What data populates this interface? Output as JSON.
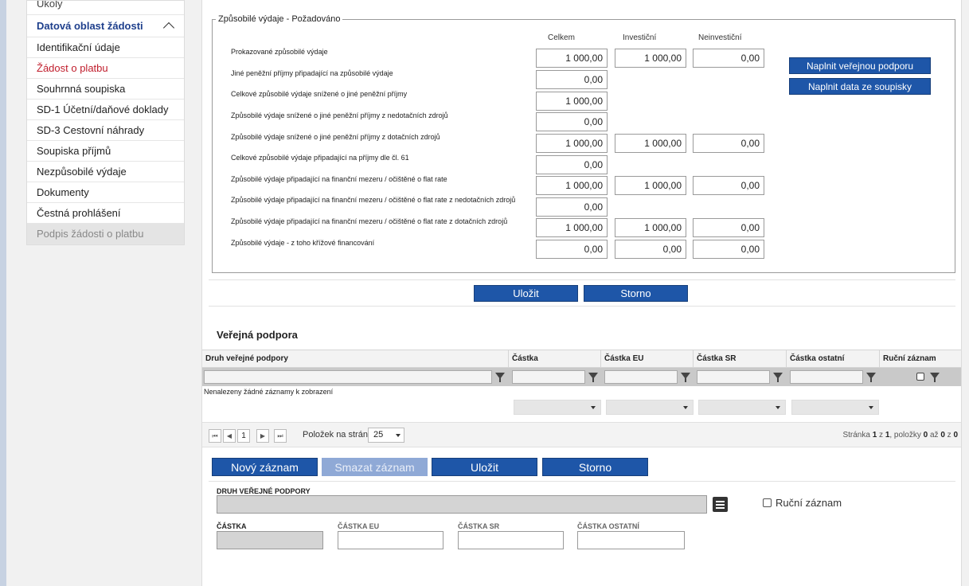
{
  "sidebar": {
    "items": [
      {
        "label": "Úkoly",
        "state": "cut"
      },
      {
        "label": "Datová oblast žádosti",
        "state": "section"
      },
      {
        "label": "Identifikační údaje",
        "state": "normal"
      },
      {
        "label": "Žádost o platbu",
        "state": "active"
      },
      {
        "label": "Souhrnná soupiska",
        "state": "normal"
      },
      {
        "label": "SD-1 Účetní/daňové doklady",
        "state": "normal"
      },
      {
        "label": "SD-3 Cestovní náhrady",
        "state": "normal"
      },
      {
        "label": "Soupiska příjmů",
        "state": "normal"
      },
      {
        "label": "Nezpůsobilé výdaje",
        "state": "normal"
      },
      {
        "label": "Dokumenty",
        "state": "normal"
      },
      {
        "label": "Čestná prohlášení",
        "state": "normal"
      },
      {
        "label": "Podpis žádosti o platbu",
        "state": "disabled"
      }
    ]
  },
  "expenses": {
    "legend": "Způsobilé výdaje - Požadováno",
    "columns": [
      "Celkem",
      "Investiční",
      "Neinvestiční"
    ],
    "rows": [
      {
        "label": "Prokazované způsobilé výdaje",
        "values": [
          "1 000,00",
          "1 000,00",
          "0,00"
        ]
      },
      {
        "label": "Jiné peněžní příjmy připadající na způsobilé výdaje",
        "values": [
          "0,00"
        ]
      },
      {
        "label": "Celkové způsobilé výdaje snížené o jiné peněžní příjmy",
        "values": [
          "1 000,00"
        ]
      },
      {
        "label": "Způsobilé výdaje snížené o jiné peněžní příjmy z nedotačních zdrojů",
        "values": [
          "0,00"
        ]
      },
      {
        "label": "Způsobilé výdaje snížené o jiné peněžní příjmy z dotačních zdrojů",
        "values": [
          "1 000,00",
          "1 000,00",
          "0,00"
        ]
      },
      {
        "label": "Celkové způsobilé výdaje připadající na příjmy dle čl. 61",
        "values": [
          "0,00"
        ]
      },
      {
        "label": "Způsobilé výdaje připadající na finanční mezeru / očištěné o flat rate",
        "values": [
          "1 000,00",
          "1 000,00",
          "0,00"
        ]
      },
      {
        "label": "Způsobilé výdaje připadající na finanční mezeru / očištěné o flat rate z nedotačních zdrojů",
        "values": [
          "0,00"
        ]
      },
      {
        "label": "Způsobilé výdaje připadající na finanční mezeru / očištěné o flat rate z dotačních zdrojů",
        "values": [
          "1 000,00",
          "1 000,00",
          "0,00"
        ]
      },
      {
        "label": "Způsobilé výdaje - z toho křížové financování",
        "values": [
          "0,00",
          "0,00",
          "0,00"
        ]
      }
    ],
    "btn_verejna": "Naplnit veřejnou podporu",
    "btn_soupisky": "Naplnit data ze soupisky"
  },
  "actions": {
    "save": "Uložit",
    "cancel": "Storno"
  },
  "vp": {
    "title": "Veřejná podpora",
    "columns": [
      "Druh veřejné podpory",
      "Částka",
      "Částka EU",
      "Částka SR",
      "Částka ostatní",
      "Ruční záznam"
    ],
    "empty": "Nenalezeny žádné záznamy k zobrazení",
    "pager": {
      "first": "⏮",
      "prev": "◀",
      "page": "1",
      "next": "▶",
      "last": "⏭",
      "per_page_label": "Položek na stránku",
      "per_page": "25",
      "info_prefix": "Stránka ",
      "page_cur": "1",
      "info_of": " z ",
      "page_total": "1",
      "info_items": ", položky ",
      "item_from": "0",
      "info_to": " až ",
      "item_to": "0",
      "info_of2": " z ",
      "item_total": "0"
    }
  },
  "form_buttons": {
    "new": "Nový záznam",
    "delete": "Smazat záznam",
    "save": "Uložit",
    "cancel": "Storno"
  },
  "form": {
    "druh_label": "DRUH VEŘEJNÉ PODPORY",
    "rucni_label": "Ruční záznam",
    "castka_label": "ČÁSTKA",
    "castka_eu_label": "ČÁSTKA EU",
    "castka_sr_label": "ČÁSTKA SR",
    "castka_ostatni_label": "ČÁSTKA OSTATNÍ"
  }
}
